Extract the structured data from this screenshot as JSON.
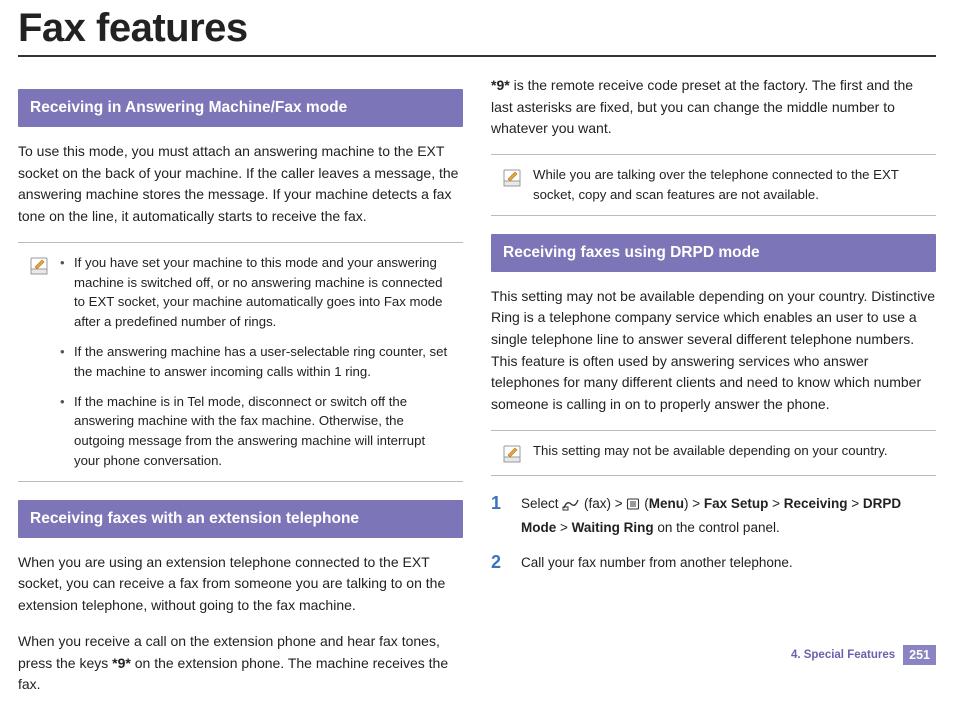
{
  "page": {
    "title": "Fax features"
  },
  "left": {
    "section1": {
      "header": "Receiving in Answering Machine/Fax mode",
      "para": "To use this mode, you must attach an answering machine to the EXT socket on the back of your machine. If the caller leaves a message, the answering machine stores the message. If your machine detects a fax tone on the line, it automatically starts to receive the fax.",
      "note_items": [
        "If you have set your machine to this mode and your answering machine is switched off, or no answering machine is connected to EXT socket, your machine automatically goes into Fax mode after a predefined number of rings.",
        "If the answering machine has a user-selectable ring counter, set the machine to answer incoming calls within 1 ring.",
        "If the machine is in Tel mode, disconnect or switch off the answering machine with the fax machine. Otherwise, the outgoing message from the answering machine will interrupt your phone conversation."
      ]
    },
    "section2": {
      "header": "Receiving faxes with an extension telephone",
      "para1": "When you are using an extension telephone connected to the EXT socket, you can receive a fax from someone you are talking to on the extension telephone, without going to the fax machine.",
      "para2_prefix": "When you receive a call on the extension phone and hear fax tones, press the keys ",
      "para2_code": "*9*",
      "para2_suffix": " on the extension phone. The machine receives the fax."
    }
  },
  "right": {
    "top_para_code": "*9*",
    "top_para_rest": " is the remote receive code preset at the factory. The first and the last asterisks are fixed, but you can change the middle number to whatever you want.",
    "note1": "While you are talking over the telephone connected to the EXT socket, copy and scan features are not available.",
    "section3": {
      "header": "Receiving faxes using DRPD mode",
      "para": "This setting may not be available depending on your country. Distinctive Ring is a telephone company service which enables an user to use a single telephone line to answer several different telephone numbers. This feature is often used by answering services who answer telephones for many different clients and need to know which number someone is calling in on to properly answer the phone.",
      "note": "This setting may not be available depending on your country.",
      "step1": {
        "t1": "Select ",
        "t_fax": " (fax) > ",
        "t_menu_open": " (",
        "t_menu": "Menu",
        "t_menu_close": ") > ",
        "t_fs": "Fax Setup",
        "gt1": " > ",
        "t_recv": "Receiving",
        "gt2": " > ",
        "t_drpd": "DRPD Mode",
        "gt3": " > ",
        "t_wait": "Waiting Ring",
        "t_end": " on the control panel."
      },
      "step2": "Call your fax number from another telephone."
    }
  },
  "footer": {
    "chapter": "4.  Special Features",
    "page": "251"
  }
}
